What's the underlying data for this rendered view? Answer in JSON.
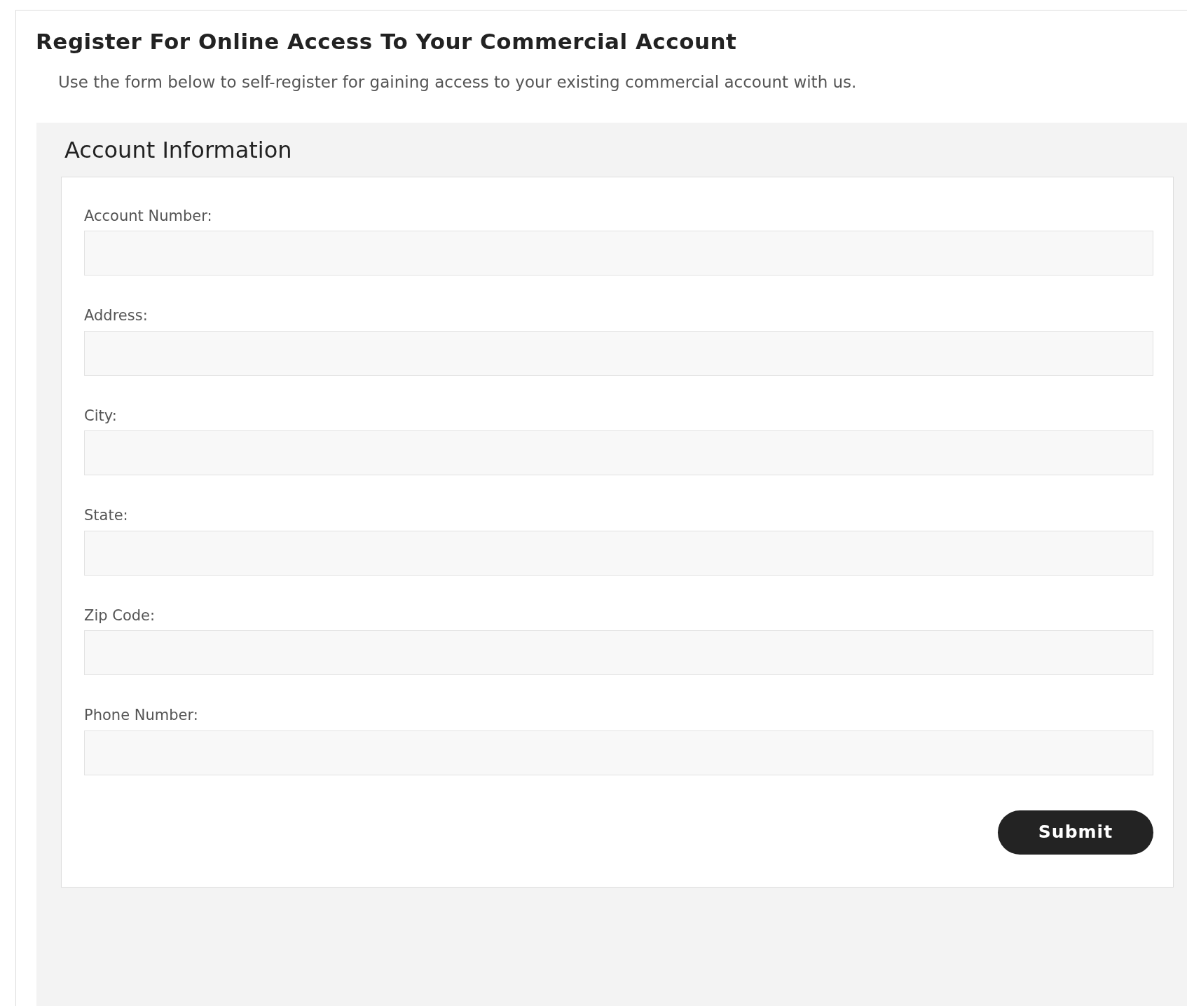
{
  "title": "Register For Online Access To Your Commercial Account",
  "description": "Use the form below to self-register for gaining access to your existing commercial account with us.",
  "section": {
    "title": "Account Information",
    "fields": [
      {
        "label": "Account Number:"
      },
      {
        "label": "Address:"
      },
      {
        "label": "City:"
      },
      {
        "label": "State:"
      },
      {
        "label": "Zip Code:"
      },
      {
        "label": "Phone Number:"
      }
    ],
    "submit": "Submit"
  }
}
